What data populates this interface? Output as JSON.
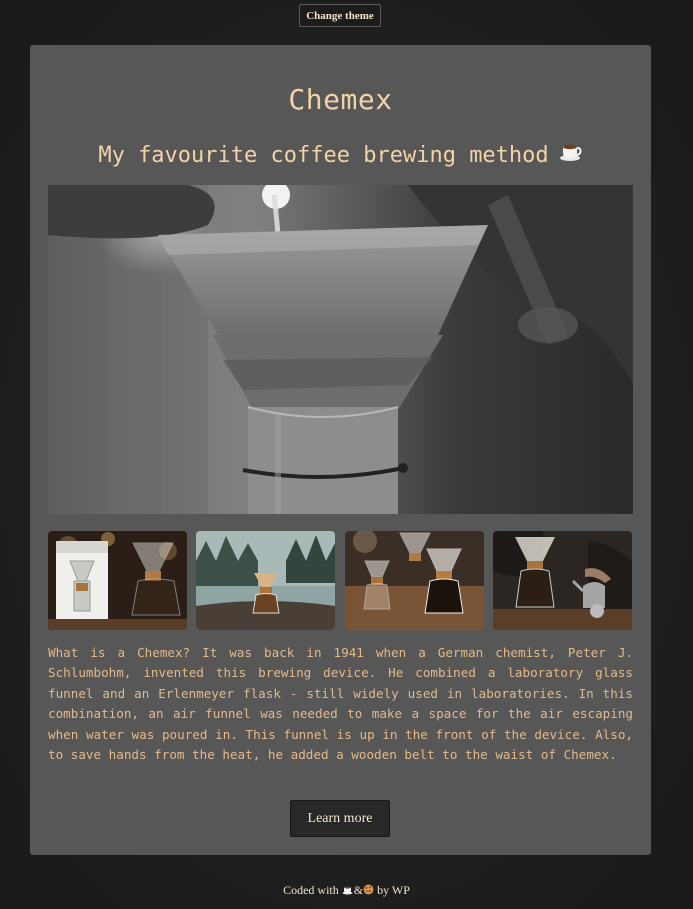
{
  "header": {
    "change_theme_label": "Change theme"
  },
  "card": {
    "title": "Chemex",
    "subtitle": "My favourite coffee brewing method",
    "subtitle_icon": "coffee-cup-icon",
    "hero_image": "pour-over-chemex-grayscale-photo",
    "gallery": [
      "chemex-box-and-flask-photo",
      "chemex-on-rock-lake-photo",
      "chemex-flasks-on-wood-photo",
      "barista-pouring-chemex-photo"
    ],
    "description": "What is a Chemex? It was back in 1941 when a German chemist, Peter J. Schlumbohm, invented this brewing device. He combined a laboratory glass funnel and an Erlenmeyer flask - still widely used in laboratories. In this combination, an air funnel was needed to make a space for the air escaping when water was poured in. This funnel is up in the front of the device. Also, to save hands from the heat, he added a wooden belt to the waist of Chemex.",
    "learn_more_label": "Learn more"
  },
  "footer": {
    "prefix": "Coded with",
    "icons": [
      "coffee-cup-icon",
      "cookie-icon"
    ],
    "amp": "&",
    "suffix": "by WP"
  },
  "colors": {
    "page_background": "#222222",
    "card_background": "#575757",
    "accent_text": "#f2d3a6",
    "body_text": "#e3b98a"
  }
}
